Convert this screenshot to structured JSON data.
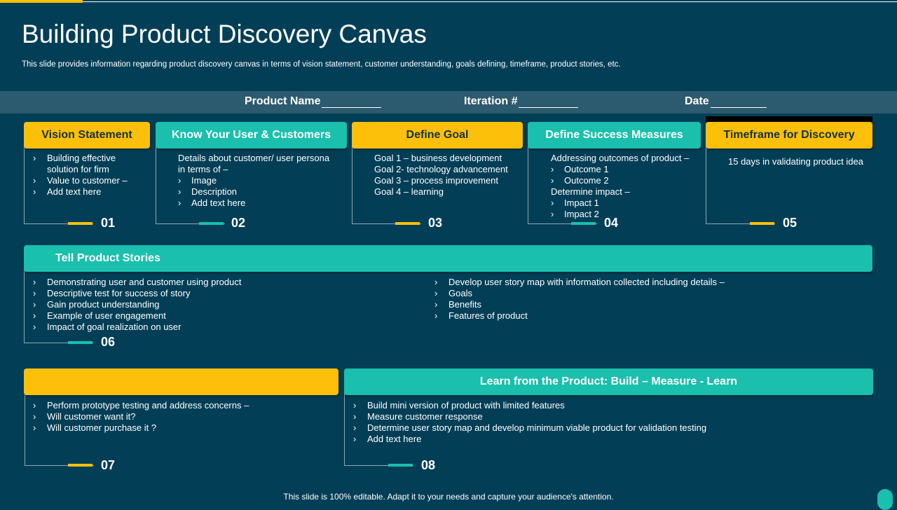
{
  "title": "Building Product Discovery Canvas",
  "subtitle": "This slide provides information regarding product discovery canvas in terms of vision statement, customer understanding, goals defining, timeframe, product stories, etc.",
  "fields": {
    "product_name": "Product Name",
    "iteration": "Iteration #",
    "date": "Date"
  },
  "colors": {
    "background": "#023f57",
    "yellow": "#fcbf0a",
    "teal": "#1abfad",
    "field_bar": "#2c5a6e"
  },
  "cards": [
    {
      "header": "Vision Statement",
      "number": "01",
      "lines": [
        "Building effective",
        "solution for firm",
        "Value to customer –",
        "Add text here"
      ]
    },
    {
      "header": "Know Your User & Customers",
      "number": "02",
      "lines": [
        "Details about customer/ user persona",
        "in terms of –",
        "Image",
        "Description",
        "Add text here"
      ]
    },
    {
      "header": "Define Goal",
      "number": "03",
      "lines": [
        "Goal 1 – business development",
        "Goal 2- technology advancement",
        "Goal 3 – process improvement",
        "Goal 4 – learning"
      ]
    },
    {
      "header": "Define Success Measures",
      "number": "04",
      "lines": [
        "Addressing outcomes of product –",
        "Outcome 1",
        "Outcome 2",
        "Determine impact –",
        "Impact 1",
        "Impact 2"
      ]
    },
    {
      "header": "Timeframe for Discovery",
      "number": "05",
      "lines": [
        "15 days in validating  product idea"
      ]
    }
  ],
  "stories": {
    "header": "Tell Product Stories",
    "number": "06",
    "left": [
      "Demonstrating user and customer using product",
      "Descriptive test for success of story",
      "Gain product understanding",
      "Example of user engagement",
      "Impact of goal realization on user"
    ],
    "right": [
      "Develop user story map with information collected including details –",
      "Goals",
      "Benefits",
      "Features of product"
    ]
  },
  "card7": {
    "header": "",
    "number": "07",
    "lines": [
      "Perform prototype testing and address concerns –",
      "Will customer want it?",
      "Will customer purchase it ?"
    ]
  },
  "card8": {
    "header": "Learn from the Product: Build – Measure  - Learn",
    "number": "08",
    "lines": [
      "Build mini version  of product with limited features",
      "Measure customer response",
      "Determine  user story map and develop  minimum viable  product for validation  testing",
      "Add text here"
    ]
  },
  "bullet_glyph": "›",
  "footer": "This slide is 100% editable. Adapt it to your needs and capture your audience's attention."
}
